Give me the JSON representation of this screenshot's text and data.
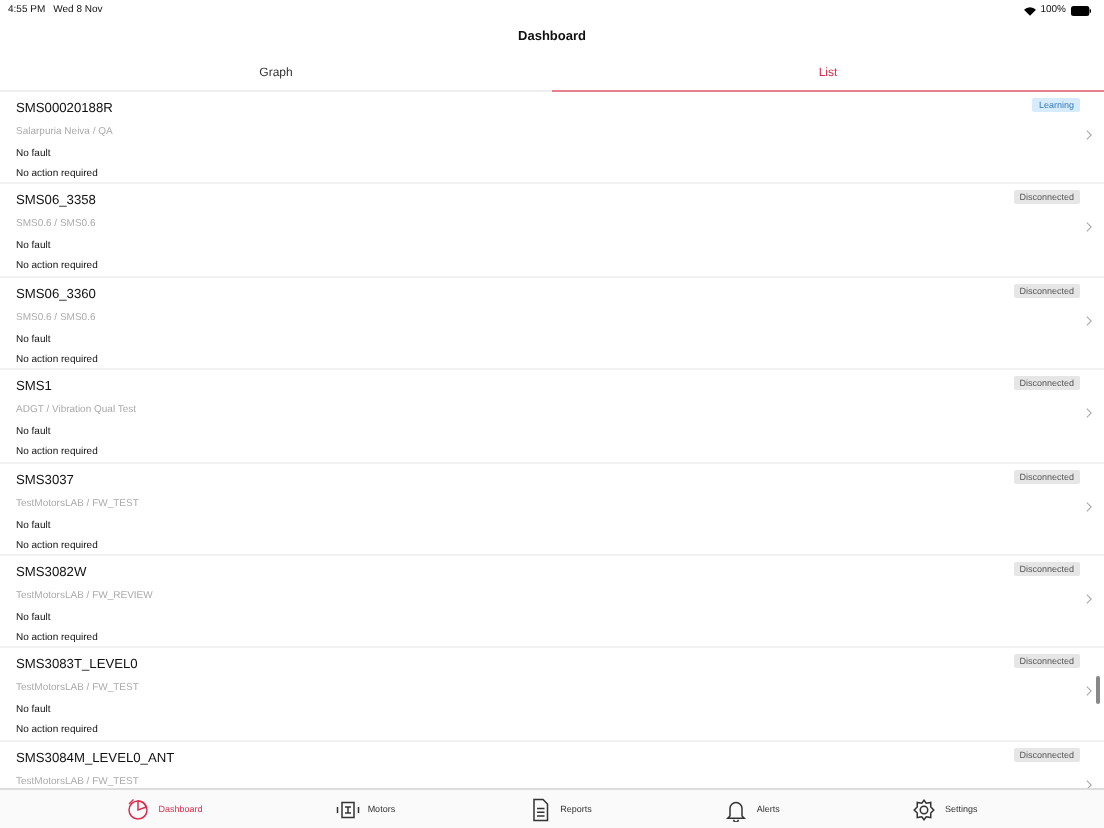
{
  "status_bar": {
    "time": "4:55 PM",
    "date": "Wed 8 Nov",
    "battery_text": "100%"
  },
  "window": {
    "title": "Dashboard"
  },
  "tabs": [
    {
      "label": "Graph",
      "selected": false
    },
    {
      "label": "List",
      "selected": true
    }
  ],
  "devices": [
    {
      "name": "SMS00020188R",
      "location": "Salarpuria Neiva / QA",
      "fault": "No fault",
      "action": "No action required",
      "status": "Learning",
      "kind": "learning"
    },
    {
      "name": "SMS06_3358",
      "location": "SMS0.6 / SMS0.6",
      "fault": "No fault",
      "action": "No action required",
      "status": "Disconnected",
      "kind": "disconnected"
    },
    {
      "name": "SMS06_3360",
      "location": "SMS0.6 / SMS0.6",
      "fault": "No fault",
      "action": "No action required",
      "status": "Disconnected",
      "kind": "disconnected"
    },
    {
      "name": "SMS1",
      "location": "ADGT /  Vibration Qual Test",
      "fault": "No fault",
      "action": "No action required",
      "status": "Disconnected",
      "kind": "disconnected"
    },
    {
      "name": "SMS3037",
      "location": "TestMotorsLAB / FW_TEST",
      "fault": "No fault",
      "action": "No action required",
      "status": "Disconnected",
      "kind": "disconnected"
    },
    {
      "name": "SMS3082W",
      "location": "TestMotorsLAB / FW_REVIEW",
      "fault": "No fault",
      "action": "No action required",
      "status": "Disconnected",
      "kind": "disconnected"
    },
    {
      "name": "SMS3083T_LEVEL0",
      "location": "TestMotorsLAB / FW_TEST",
      "fault": "No fault",
      "action": "No action required",
      "status": "Disconnected",
      "kind": "disconnected"
    },
    {
      "name": "SMS3084M_LEVEL0_ANT",
      "location": "TestMotorsLAB / FW_TEST",
      "status": "Disconnected",
      "kind": "disconnected"
    }
  ],
  "tab_bar": [
    {
      "label": "Dashboard",
      "selected": true
    },
    {
      "label": "Motors",
      "selected": false
    },
    {
      "label": "Reports",
      "selected": false
    },
    {
      "label": "Alerts",
      "selected": false
    },
    {
      "label": "Settings",
      "selected": false
    }
  ]
}
